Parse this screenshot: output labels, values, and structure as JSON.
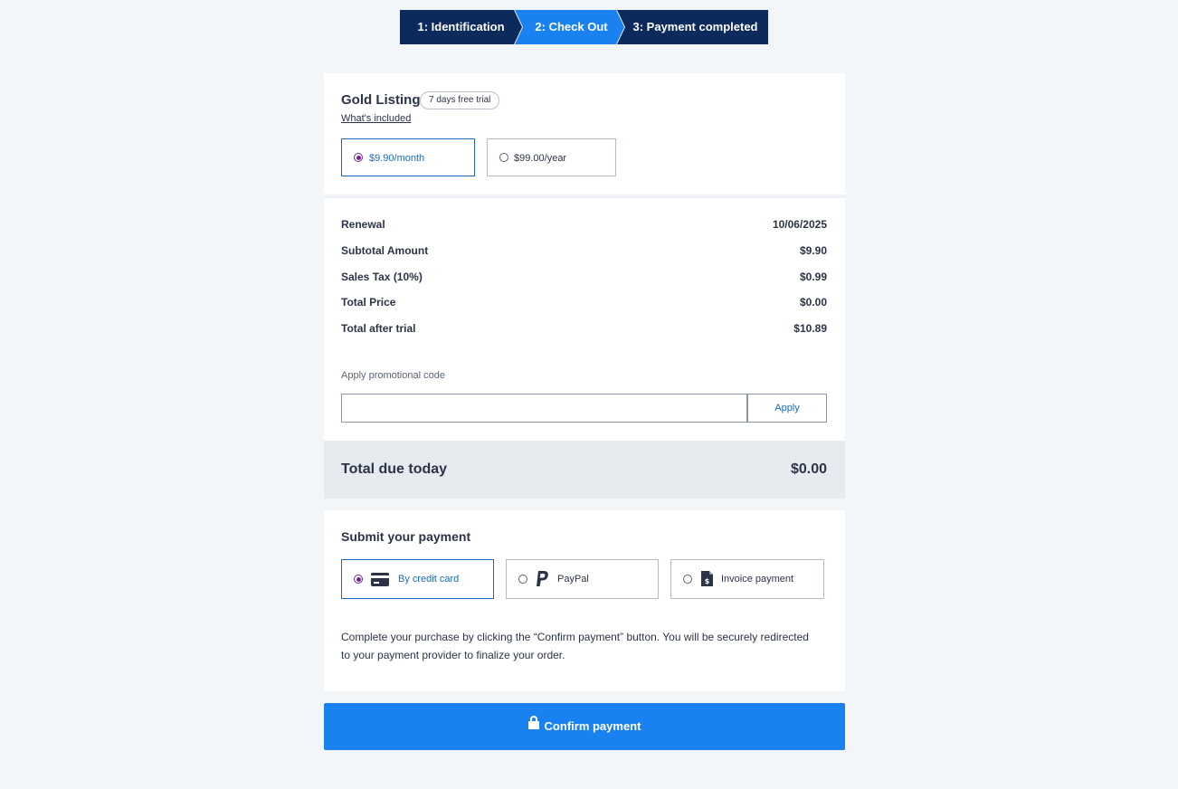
{
  "stepper": {
    "steps": [
      {
        "label": "1: Identification"
      },
      {
        "label": "2: Check Out"
      },
      {
        "label": "3: Payment completed"
      }
    ]
  },
  "plan": {
    "title": "Gold Listing",
    "badge": "7 days free trial",
    "included_link": "What's included",
    "options": [
      {
        "label": "$9.90/month",
        "selected": true
      },
      {
        "label": "$99.00/year",
        "selected": false
      }
    ]
  },
  "summary": {
    "rows": [
      {
        "label": "Renewal",
        "value": "10/06/2025"
      },
      {
        "label": "Subtotal Amount",
        "value": "$9.90"
      },
      {
        "label": "Sales Tax (10%)",
        "value": "$0.99"
      },
      {
        "label": "Total Price",
        "value": "$0.00"
      },
      {
        "label": "Total after trial",
        "value": "$10.89"
      }
    ],
    "promo": {
      "label": "Apply promotional code",
      "value": "",
      "placeholder": "",
      "apply_label": "Apply"
    }
  },
  "total": {
    "label": "Total due today",
    "value": "$0.00"
  },
  "payment": {
    "title": "Submit your payment",
    "methods": [
      {
        "label": "By credit card",
        "icon": "credit-card-icon",
        "selected": true
      },
      {
        "label": "PayPal",
        "icon": "paypal-icon",
        "selected": false
      },
      {
        "label": "Invoice payment",
        "icon": "invoice-icon",
        "selected": false
      }
    ],
    "note": "Complete your purchase by clicking the “Confirm payment” button. You will be securely redirected to your payment provider to finalize your order."
  },
  "confirm": {
    "label": "Confirm payment",
    "icon": "lock-icon"
  },
  "colors": {
    "navy": "#0c2a5b",
    "accent": "#1a82f0",
    "radio_selected": "#7a1f8f",
    "page_bg": "#f3f6f9"
  }
}
